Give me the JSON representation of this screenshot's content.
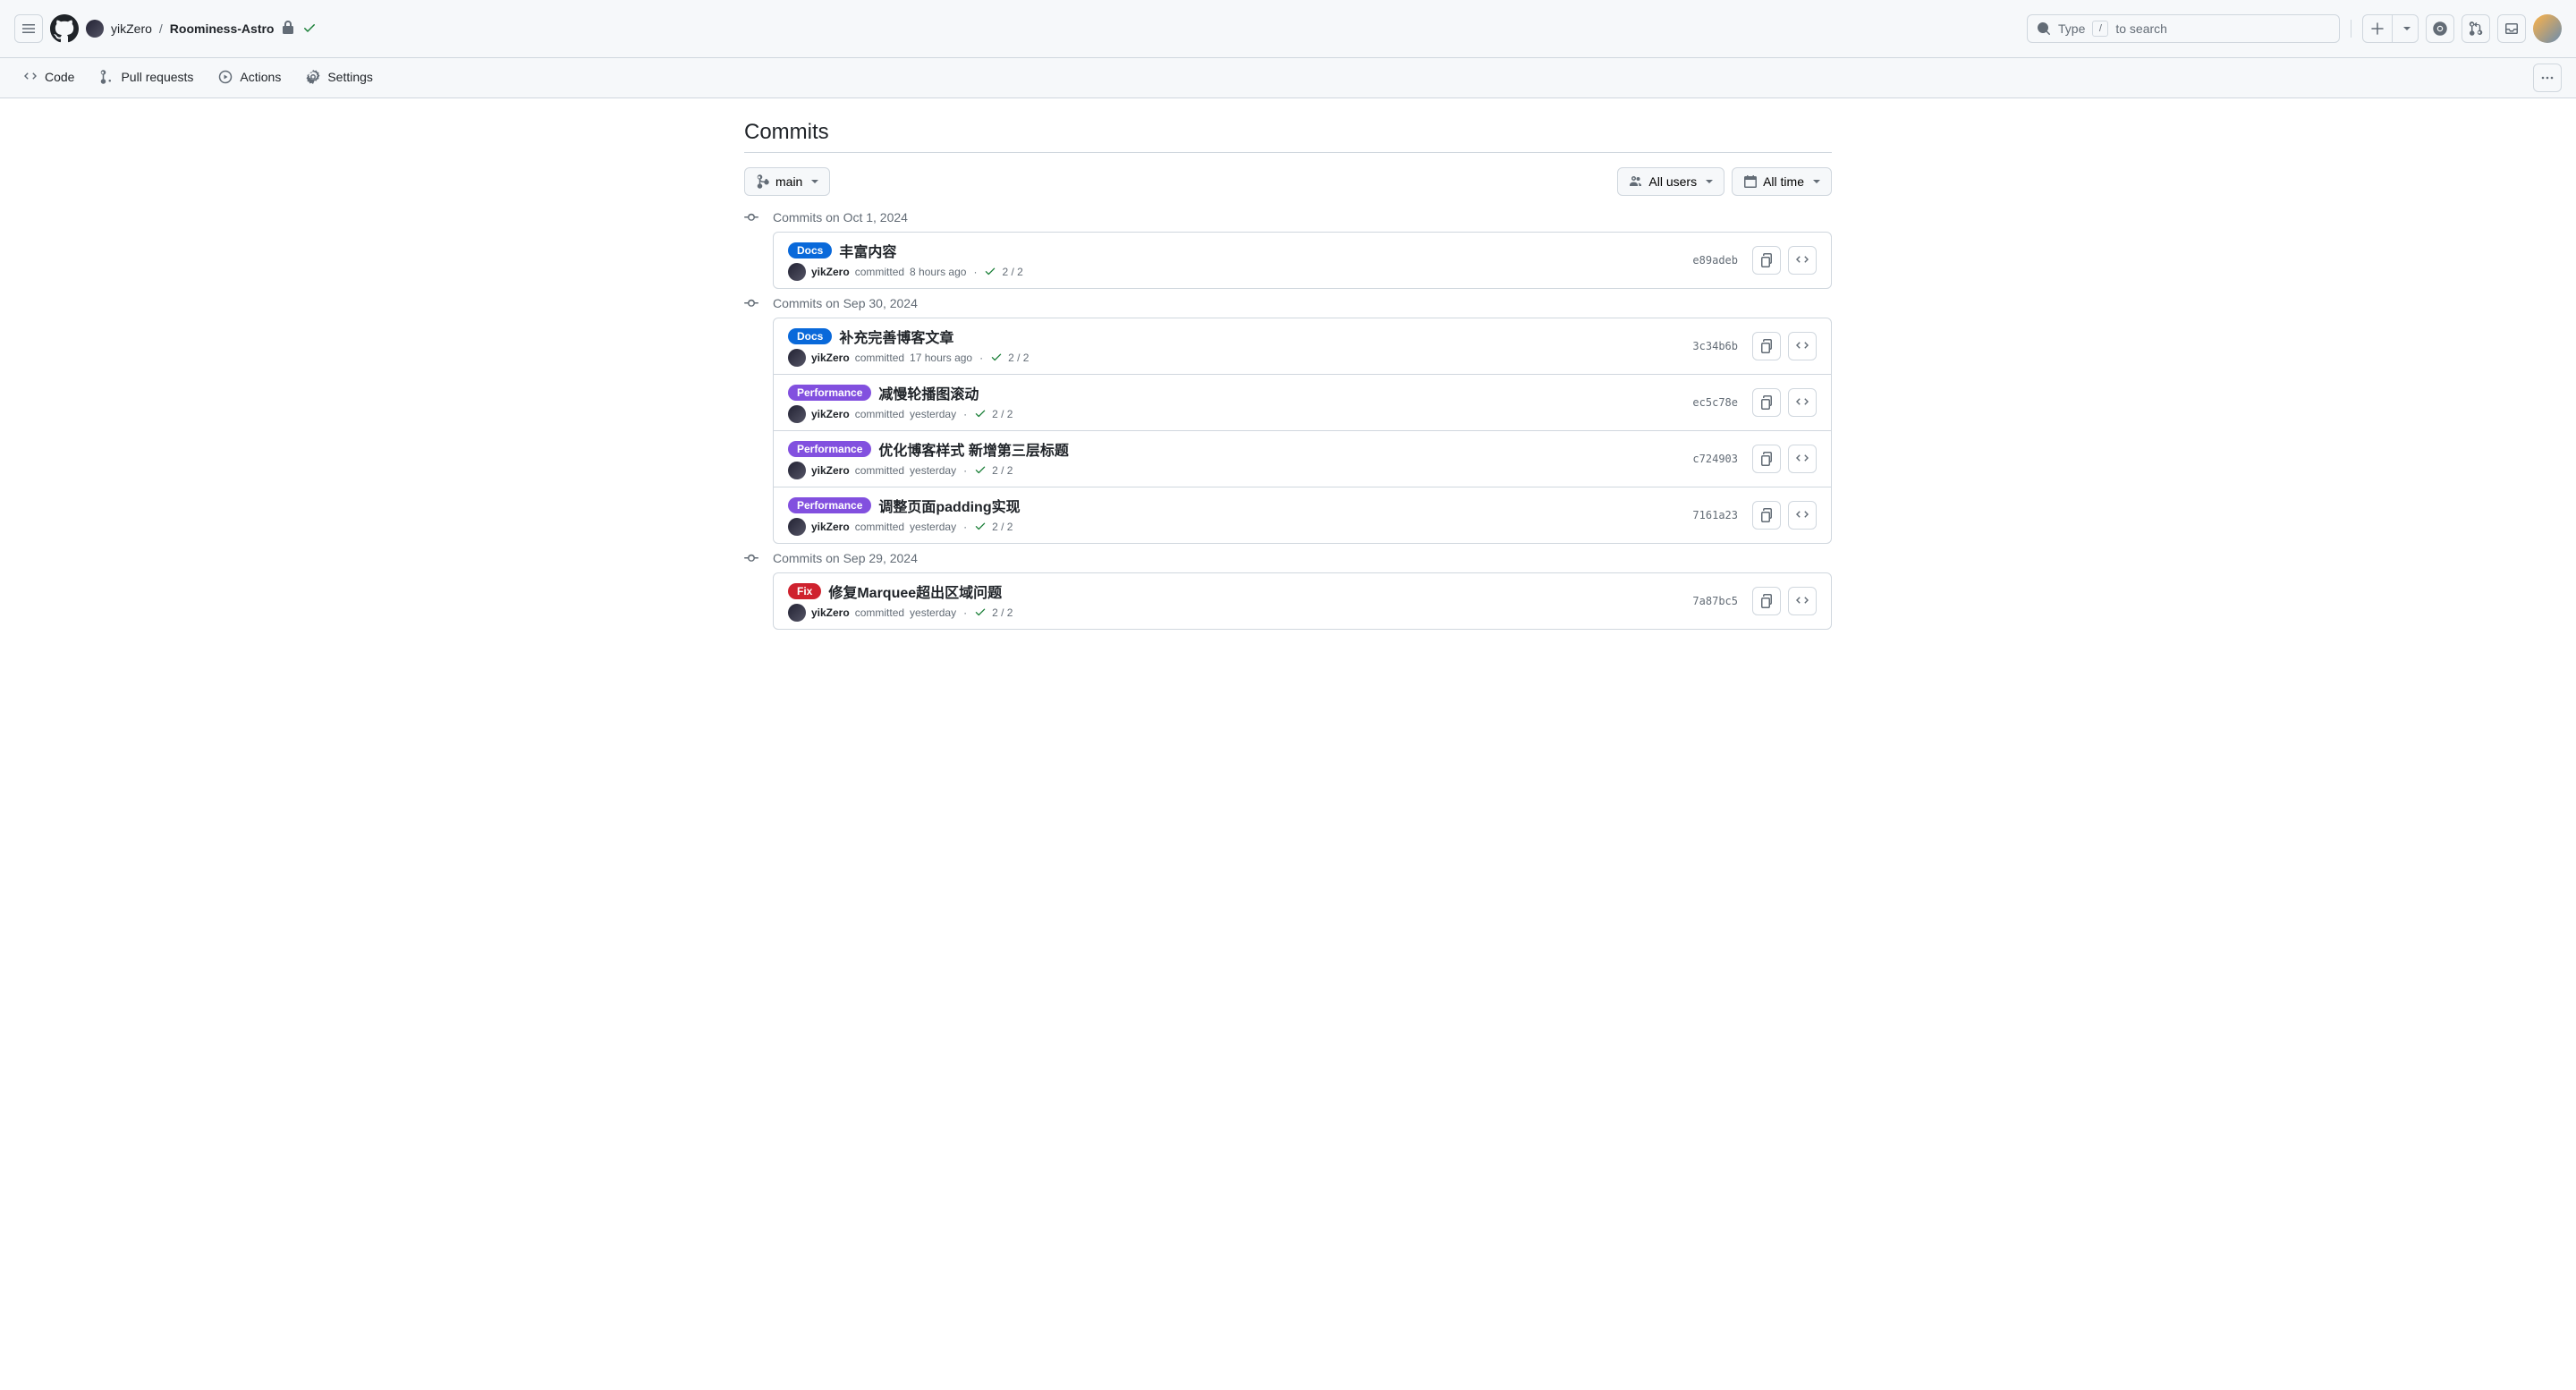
{
  "breadcrumb": {
    "owner": "yikZero",
    "sep": "/",
    "repo": "Roominess-Astro"
  },
  "search": {
    "placeholder_prefix": "Type ",
    "slash": "/",
    "placeholder_suffix": " to search"
  },
  "tabs": {
    "code": "Code",
    "pull": "Pull requests",
    "actions": "Actions",
    "settings": "Settings"
  },
  "page": {
    "title": "Commits"
  },
  "filters": {
    "branch": "main",
    "users": "All users",
    "time": "All time"
  },
  "badge_colors": {
    "Docs": "#0969da",
    "Performance": "#8250df",
    "Fix": "#cf222e",
    "Feature": "#2da199"
  },
  "groups": [
    {
      "label": "Commits on Oct 1, 2024",
      "commits": [
        {
          "badge": "Docs",
          "title": "丰富内容",
          "author": "yikZero",
          "committed": "committed",
          "time": "8 hours ago",
          "status": "2 / 2",
          "hash": "e89adeb"
        }
      ]
    },
    {
      "label": "Commits on Sep 30, 2024",
      "commits": [
        {
          "badge": "Docs",
          "title": "补充完善博客文章",
          "author": "yikZero",
          "committed": "committed",
          "time": "17 hours ago",
          "status": "2 / 2",
          "hash": "3c34b6b"
        },
        {
          "badge": "Performance",
          "title": "减慢轮播图滚动",
          "author": "yikZero",
          "committed": "committed",
          "time": "yesterday",
          "status": "2 / 2",
          "hash": "ec5c78e"
        },
        {
          "badge": "Performance",
          "title": "优化博客样式 新增第三层标题",
          "author": "yikZero",
          "committed": "committed",
          "time": "yesterday",
          "status": "2 / 2",
          "hash": "c724903"
        },
        {
          "badge": "Performance",
          "title": "调整页面padding实现",
          "author": "yikZero",
          "committed": "committed",
          "time": "yesterday",
          "status": "2 / 2",
          "hash": "7161a23"
        }
      ]
    },
    {
      "label": "Commits on Sep 29, 2024",
      "commits": [
        {
          "badge": "Fix",
          "title": "修复Marquee超出区域问题",
          "author": "yikZero",
          "committed": "committed",
          "time": "yesterday",
          "status": "2 / 2",
          "hash": "7a87bc5"
        }
      ]
    }
  ]
}
